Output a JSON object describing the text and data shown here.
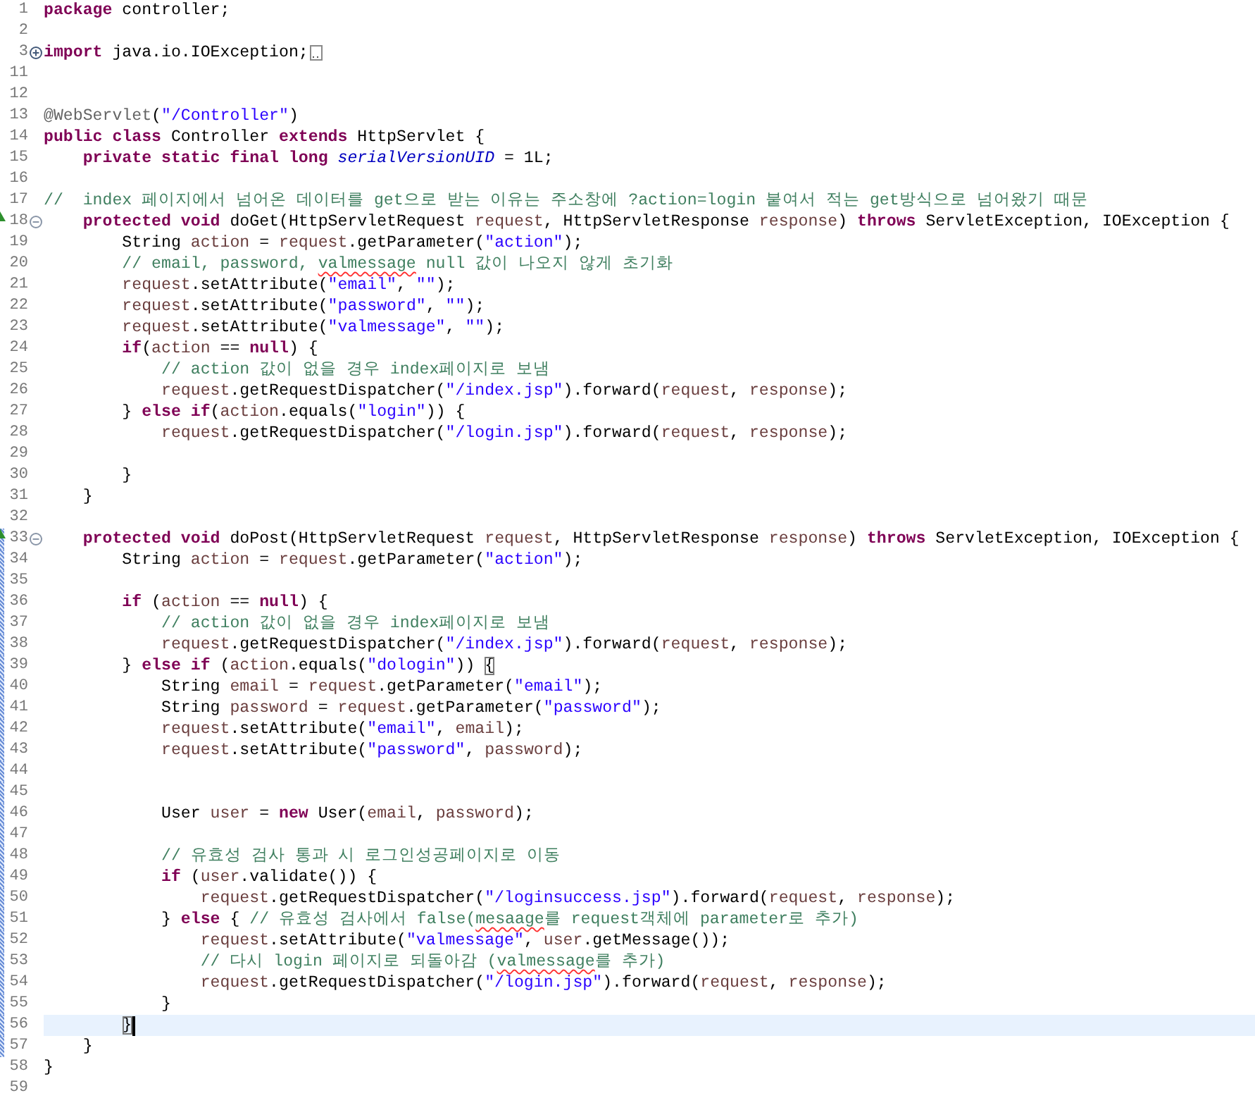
{
  "editor": {
    "lines": [
      {
        "number": "1",
        "changed": false,
        "override": false,
        "current": false,
        "tokens": [
          {
            "kind": "kw",
            "text": "package"
          },
          {
            "kind": "plain",
            "text": " controller;"
          }
        ]
      },
      {
        "number": "2",
        "changed": false,
        "override": false,
        "current": false
      },
      {
        "number": "3",
        "changed": false,
        "override": false,
        "current": false,
        "fold": {
          "collapsed": true
        },
        "tokens": [
          {
            "kind": "kw",
            "text": "import"
          },
          {
            "kind": "plain",
            "text": " java.io.IOException;"
          }
        ]
      },
      {
        "number": "11",
        "changed": false,
        "override": false,
        "current": false
      },
      {
        "number": "12",
        "changed": false,
        "override": false,
        "current": false
      },
      {
        "number": "13",
        "changed": false,
        "override": false,
        "current": false,
        "tokens": [
          {
            "kind": "ann",
            "text": "@WebServlet"
          },
          {
            "kind": "plain",
            "text": "("
          },
          {
            "kind": "str",
            "text": "\"/Controller\""
          },
          {
            "kind": "plain",
            "text": ")"
          }
        ]
      },
      {
        "number": "14",
        "changed": false,
        "override": false,
        "current": false,
        "tokens": [
          {
            "kind": "kw",
            "text": "public"
          },
          {
            "kind": "kw",
            "text": " class"
          },
          {
            "kind": "plain",
            "text": " Controller "
          },
          {
            "kind": "kw",
            "text": "extends"
          },
          {
            "kind": "plain",
            "text": " HttpServlet {"
          }
        ]
      },
      {
        "number": "15",
        "changed": false,
        "override": false,
        "current": false,
        "tokens": [
          {
            "kind": "kw",
            "text": "    private"
          },
          {
            "kind": "kw",
            "text": " static"
          },
          {
            "kind": "kw",
            "text": " final"
          },
          {
            "kind": "kw",
            "text": " long"
          },
          {
            "kind": "field",
            "text": " serialVersionUID"
          },
          {
            "kind": "plain",
            "text": " = 1L;"
          }
        ]
      },
      {
        "number": "16",
        "changed": false,
        "override": false,
        "current": false
      },
      {
        "number": "17",
        "changed": false,
        "override": false,
        "current": false,
        "tokens": [
          {
            "kind": "com",
            "text": "//  index 페이지에서 넘어온 데이터를 get으로 받는 이유는 주소창에 ?action=login 붙여서 적는 get방식으로 넘어왔기 때문"
          }
        ]
      },
      {
        "number": "18",
        "changed": false,
        "override": true,
        "current": false,
        "fold": {
          "collapsed": false
        },
        "tokens": [
          {
            "kind": "kw",
            "text": "    protected"
          },
          {
            "kind": "kw",
            "text": " void"
          },
          {
            "kind": "plain",
            "text": " doGet(HttpServletRequest "
          },
          {
            "kind": "var",
            "text": "request"
          },
          {
            "kind": "plain",
            "text": ", HttpServletResponse "
          },
          {
            "kind": "var",
            "text": "response"
          },
          {
            "kind": "plain",
            "text": ") "
          },
          {
            "kind": "kw",
            "text": "throws"
          },
          {
            "kind": "plain",
            "text": " ServletException, IOException {"
          }
        ]
      },
      {
        "number": "19",
        "changed": false,
        "override": false,
        "current": false,
        "tokens": [
          {
            "kind": "plain",
            "text": "        String "
          },
          {
            "kind": "var",
            "text": "action"
          },
          {
            "kind": "plain",
            "text": " = "
          },
          {
            "kind": "var",
            "text": "request"
          },
          {
            "kind": "plain",
            "text": ".getParameter("
          },
          {
            "kind": "str",
            "text": "\"action\""
          },
          {
            "kind": "plain",
            "text": ");"
          }
        ]
      },
      {
        "number": "20",
        "changed": false,
        "override": false,
        "current": false,
        "tokens": [
          {
            "kind": "com",
            "text": "        // email, password, "
          },
          {
            "kind": "typo",
            "text": "valmessage"
          },
          {
            "kind": "com",
            "text": " null 값이 나오지 않게 초기화"
          }
        ]
      },
      {
        "number": "21",
        "changed": false,
        "override": false,
        "current": false,
        "tokens": [
          {
            "kind": "var",
            "text": "        request"
          },
          {
            "kind": "plain",
            "text": ".setAttribute("
          },
          {
            "kind": "str",
            "text": "\"email\""
          },
          {
            "kind": "plain",
            "text": ", "
          },
          {
            "kind": "str",
            "text": "\"\""
          },
          {
            "kind": "plain",
            "text": ");"
          }
        ]
      },
      {
        "number": "22",
        "changed": false,
        "override": false,
        "current": false,
        "tokens": [
          {
            "kind": "var",
            "text": "        request"
          },
          {
            "kind": "plain",
            "text": ".setAttribute("
          },
          {
            "kind": "str",
            "text": "\"password\""
          },
          {
            "kind": "plain",
            "text": ", "
          },
          {
            "kind": "str",
            "text": "\"\""
          },
          {
            "kind": "plain",
            "text": ");"
          }
        ]
      },
      {
        "number": "23",
        "changed": false,
        "override": false,
        "current": false,
        "tokens": [
          {
            "kind": "var",
            "text": "        request"
          },
          {
            "kind": "plain",
            "text": ".setAttribute("
          },
          {
            "kind": "str",
            "text": "\"valmessage\""
          },
          {
            "kind": "plain",
            "text": ", "
          },
          {
            "kind": "str",
            "text": "\"\""
          },
          {
            "kind": "plain",
            "text": ");"
          }
        ]
      },
      {
        "number": "24",
        "changed": false,
        "override": false,
        "current": false,
        "tokens": [
          {
            "kind": "kw",
            "text": "        if"
          },
          {
            "kind": "plain",
            "text": "("
          },
          {
            "kind": "var",
            "text": "action"
          },
          {
            "kind": "plain",
            "text": " == "
          },
          {
            "kind": "kw",
            "text": "null"
          },
          {
            "kind": "plain",
            "text": ") {"
          }
        ]
      },
      {
        "number": "25",
        "changed": false,
        "override": false,
        "current": false,
        "tokens": [
          {
            "kind": "com",
            "text": "            // action 값이 없을 경우 index페이지로 보냄"
          }
        ]
      },
      {
        "number": "26",
        "changed": false,
        "override": false,
        "current": false,
        "tokens": [
          {
            "kind": "var",
            "text": "            request"
          },
          {
            "kind": "plain",
            "text": ".getRequestDispatcher("
          },
          {
            "kind": "str",
            "text": "\"/index.jsp\""
          },
          {
            "kind": "plain",
            "text": ").forward("
          },
          {
            "kind": "var",
            "text": "request"
          },
          {
            "kind": "plain",
            "text": ", "
          },
          {
            "kind": "var",
            "text": "response"
          },
          {
            "kind": "plain",
            "text": ");"
          }
        ]
      },
      {
        "number": "27",
        "changed": false,
        "override": false,
        "current": false,
        "tokens": [
          {
            "kind": "plain",
            "text": "        } "
          },
          {
            "kind": "kw",
            "text": "else"
          },
          {
            "kind": "kw",
            "text": " if"
          },
          {
            "kind": "plain",
            "text": "("
          },
          {
            "kind": "var",
            "text": "action"
          },
          {
            "kind": "plain",
            "text": ".equals("
          },
          {
            "kind": "str",
            "text": "\"login\""
          },
          {
            "kind": "plain",
            "text": ")) {"
          }
        ]
      },
      {
        "number": "28",
        "changed": false,
        "override": false,
        "current": false,
        "tokens": [
          {
            "kind": "var",
            "text": "            request"
          },
          {
            "kind": "plain",
            "text": ".getRequestDispatcher("
          },
          {
            "kind": "str",
            "text": "\"/login.jsp\""
          },
          {
            "kind": "plain",
            "text": ").forward("
          },
          {
            "kind": "var",
            "text": "request"
          },
          {
            "kind": "plain",
            "text": ", "
          },
          {
            "kind": "var",
            "text": "response"
          },
          {
            "kind": "plain",
            "text": ");"
          }
        ]
      },
      {
        "number": "29",
        "changed": false,
        "override": false,
        "current": false
      },
      {
        "number": "30",
        "changed": false,
        "override": false,
        "current": false,
        "tokens": [
          {
            "kind": "plain",
            "text": "        }"
          }
        ]
      },
      {
        "number": "31",
        "changed": false,
        "override": false,
        "current": false,
        "tokens": [
          {
            "kind": "plain",
            "text": "    }"
          }
        ]
      },
      {
        "number": "32",
        "changed": false,
        "override": false,
        "current": false
      },
      {
        "number": "33",
        "changed": true,
        "override": true,
        "current": false,
        "fold": {
          "collapsed": false
        },
        "tokens": [
          {
            "kind": "kw",
            "text": "    protected"
          },
          {
            "kind": "kw",
            "text": " void"
          },
          {
            "kind": "plain",
            "text": " doPost(HttpServletRequest "
          },
          {
            "kind": "var",
            "text": "request"
          },
          {
            "kind": "plain",
            "text": ", HttpServletResponse "
          },
          {
            "kind": "var",
            "text": "response"
          },
          {
            "kind": "plain",
            "text": ") "
          },
          {
            "kind": "kw",
            "text": "throws"
          },
          {
            "kind": "plain",
            "text": " ServletException, IOException {"
          }
        ]
      },
      {
        "number": "34",
        "changed": true,
        "override": false,
        "current": false,
        "tokens": [
          {
            "kind": "plain",
            "text": "        String "
          },
          {
            "kind": "var",
            "text": "action"
          },
          {
            "kind": "plain",
            "text": " = "
          },
          {
            "kind": "var",
            "text": "request"
          },
          {
            "kind": "plain",
            "text": ".getParameter("
          },
          {
            "kind": "str",
            "text": "\"action\""
          },
          {
            "kind": "plain",
            "text": ");"
          }
        ]
      },
      {
        "number": "35",
        "changed": true,
        "override": false,
        "current": false
      },
      {
        "number": "36",
        "changed": true,
        "override": false,
        "current": false,
        "tokens": [
          {
            "kind": "kw",
            "text": "        if"
          },
          {
            "kind": "plain",
            "text": " ("
          },
          {
            "kind": "var",
            "text": "action"
          },
          {
            "kind": "plain",
            "text": " == "
          },
          {
            "kind": "kw",
            "text": "null"
          },
          {
            "kind": "plain",
            "text": ") {"
          }
        ]
      },
      {
        "number": "37",
        "changed": true,
        "override": false,
        "current": false,
        "tokens": [
          {
            "kind": "com",
            "text": "            // action 값이 없을 경우 index페이지로 보냄"
          }
        ]
      },
      {
        "number": "38",
        "changed": true,
        "override": false,
        "current": false,
        "tokens": [
          {
            "kind": "var",
            "text": "            request"
          },
          {
            "kind": "plain",
            "text": ".getRequestDispatcher("
          },
          {
            "kind": "str",
            "text": "\"/index.jsp\""
          },
          {
            "kind": "plain",
            "text": ").forward("
          },
          {
            "kind": "var",
            "text": "request"
          },
          {
            "kind": "plain",
            "text": ", "
          },
          {
            "kind": "var",
            "text": "response"
          },
          {
            "kind": "plain",
            "text": ");"
          }
        ]
      },
      {
        "number": "39",
        "changed": true,
        "override": false,
        "current": false,
        "tokens": [
          {
            "kind": "plain",
            "text": "        } "
          },
          {
            "kind": "kw",
            "text": "else"
          },
          {
            "kind": "kw",
            "text": " if"
          },
          {
            "kind": "plain",
            "text": " ("
          },
          {
            "kind": "var",
            "text": "action"
          },
          {
            "kind": "plain",
            "text": ".equals("
          },
          {
            "kind": "str",
            "text": "\"dologin\""
          },
          {
            "kind": "plain",
            "text": ")) "
          },
          {
            "kind": "bracket",
            "text": "{"
          }
        ]
      },
      {
        "number": "40",
        "changed": true,
        "override": false,
        "current": false,
        "tokens": [
          {
            "kind": "plain",
            "text": "            String "
          },
          {
            "kind": "var",
            "text": "email"
          },
          {
            "kind": "plain",
            "text": " = "
          },
          {
            "kind": "var",
            "text": "request"
          },
          {
            "kind": "plain",
            "text": ".getParameter("
          },
          {
            "kind": "str",
            "text": "\"email\""
          },
          {
            "kind": "plain",
            "text": ");"
          }
        ]
      },
      {
        "number": "41",
        "changed": true,
        "override": false,
        "current": false,
        "tokens": [
          {
            "kind": "plain",
            "text": "            String "
          },
          {
            "kind": "var",
            "text": "password"
          },
          {
            "kind": "plain",
            "text": " = "
          },
          {
            "kind": "var",
            "text": "request"
          },
          {
            "kind": "plain",
            "text": ".getParameter("
          },
          {
            "kind": "str",
            "text": "\"password\""
          },
          {
            "kind": "plain",
            "text": ");"
          }
        ]
      },
      {
        "number": "42",
        "changed": true,
        "override": false,
        "current": false,
        "tokens": [
          {
            "kind": "var",
            "text": "            request"
          },
          {
            "kind": "plain",
            "text": ".setAttribute("
          },
          {
            "kind": "str",
            "text": "\"email\""
          },
          {
            "kind": "plain",
            "text": ", "
          },
          {
            "kind": "var",
            "text": "email"
          },
          {
            "kind": "plain",
            "text": ");"
          }
        ]
      },
      {
        "number": "43",
        "changed": true,
        "override": false,
        "current": false,
        "tokens": [
          {
            "kind": "var",
            "text": "            request"
          },
          {
            "kind": "plain",
            "text": ".setAttribute("
          },
          {
            "kind": "str",
            "text": "\"password\""
          },
          {
            "kind": "plain",
            "text": ", "
          },
          {
            "kind": "var",
            "text": "password"
          },
          {
            "kind": "plain",
            "text": ");"
          }
        ]
      },
      {
        "number": "44",
        "changed": true,
        "override": false,
        "current": false
      },
      {
        "number": "45",
        "changed": true,
        "override": false,
        "current": false
      },
      {
        "number": "46",
        "changed": true,
        "override": false,
        "current": false,
        "tokens": [
          {
            "kind": "plain",
            "text": "            User "
          },
          {
            "kind": "var",
            "text": "user"
          },
          {
            "kind": "plain",
            "text": " = "
          },
          {
            "kind": "kw",
            "text": "new"
          },
          {
            "kind": "plain",
            "text": " User("
          },
          {
            "kind": "var",
            "text": "email"
          },
          {
            "kind": "plain",
            "text": ", "
          },
          {
            "kind": "var",
            "text": "password"
          },
          {
            "kind": "plain",
            "text": ");"
          }
        ]
      },
      {
        "number": "47",
        "changed": true,
        "override": false,
        "current": false
      },
      {
        "number": "48",
        "changed": true,
        "override": false,
        "current": false,
        "tokens": [
          {
            "kind": "com",
            "text": "            // 유효성 검사 통과 시 로그인성공페이지로 이동"
          }
        ]
      },
      {
        "number": "49",
        "changed": true,
        "override": false,
        "current": false,
        "tokens": [
          {
            "kind": "kw",
            "text": "            if"
          },
          {
            "kind": "plain",
            "text": " ("
          },
          {
            "kind": "var",
            "text": "user"
          },
          {
            "kind": "plain",
            "text": ".validate()) {"
          }
        ]
      },
      {
        "number": "50",
        "changed": true,
        "override": false,
        "current": false,
        "tokens": [
          {
            "kind": "var",
            "text": "                request"
          },
          {
            "kind": "plain",
            "text": ".getRequestDispatcher("
          },
          {
            "kind": "str",
            "text": "\"/loginsuccess.jsp\""
          },
          {
            "kind": "plain",
            "text": ").forward("
          },
          {
            "kind": "var",
            "text": "request"
          },
          {
            "kind": "plain",
            "text": ", "
          },
          {
            "kind": "var",
            "text": "response"
          },
          {
            "kind": "plain",
            "text": ");"
          }
        ]
      },
      {
        "number": "51",
        "changed": true,
        "override": false,
        "current": false,
        "tokens": [
          {
            "kind": "plain",
            "text": "            } "
          },
          {
            "kind": "kw",
            "text": "else"
          },
          {
            "kind": "plain",
            "text": " { "
          },
          {
            "kind": "com",
            "text": "// 유효성 검사에서 false("
          },
          {
            "kind": "typo",
            "text": "mesaage"
          },
          {
            "kind": "com",
            "text": "를 request객체에 parameter로 추가)"
          }
        ]
      },
      {
        "number": "52",
        "changed": true,
        "override": false,
        "current": false,
        "tokens": [
          {
            "kind": "var",
            "text": "                request"
          },
          {
            "kind": "plain",
            "text": ".setAttribute("
          },
          {
            "kind": "str",
            "text": "\"valmessage\""
          },
          {
            "kind": "plain",
            "text": ", "
          },
          {
            "kind": "var",
            "text": "user"
          },
          {
            "kind": "plain",
            "text": ".getMessage());"
          }
        ]
      },
      {
        "number": "53",
        "changed": true,
        "override": false,
        "current": false,
        "tokens": [
          {
            "kind": "com",
            "text": "                // 다시 login 페이지로 되돌아감 ("
          },
          {
            "kind": "typo",
            "text": "valmessage"
          },
          {
            "kind": "com",
            "text": "를 추가)"
          }
        ]
      },
      {
        "number": "54",
        "changed": true,
        "override": false,
        "current": false,
        "tokens": [
          {
            "kind": "var",
            "text": "                request"
          },
          {
            "kind": "plain",
            "text": ".getRequestDispatcher("
          },
          {
            "kind": "str",
            "text": "\"/login.jsp\""
          },
          {
            "kind": "plain",
            "text": ").forward("
          },
          {
            "kind": "var",
            "text": "request"
          },
          {
            "kind": "plain",
            "text": ", "
          },
          {
            "kind": "var",
            "text": "response"
          },
          {
            "kind": "plain",
            "text": ");"
          }
        ]
      },
      {
        "number": "55",
        "changed": true,
        "override": false,
        "current": false,
        "tokens": [
          {
            "kind": "plain",
            "text": "            }"
          }
        ]
      },
      {
        "number": "56",
        "changed": true,
        "override": false,
        "current": true,
        "tokens": [
          {
            "kind": "bracket",
            "text": "        }"
          }
        ]
      },
      {
        "number": "57",
        "changed": true,
        "override": false,
        "current": false,
        "tokens": [
          {
            "kind": "plain",
            "text": "    }"
          }
        ]
      },
      {
        "number": "58",
        "changed": false,
        "override": false,
        "current": false,
        "tokens": [
          {
            "kind": "plain",
            "text": "}"
          }
        ]
      },
      {
        "number": "59",
        "changed": false,
        "override": false,
        "current": false
      }
    ]
  }
}
